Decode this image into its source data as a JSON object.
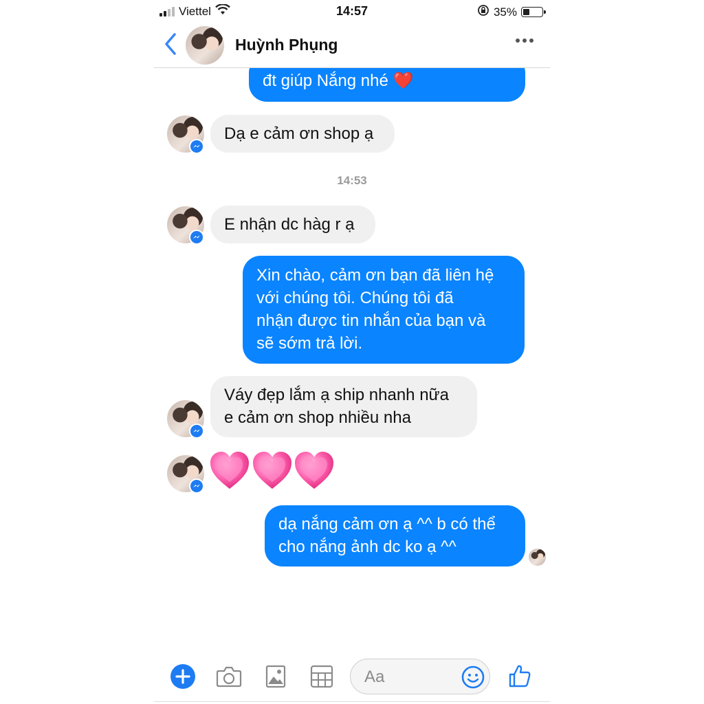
{
  "status_bar": {
    "carrier": "Viettel",
    "time": "14:57",
    "battery": "35%",
    "battery_level": 0.35
  },
  "header": {
    "contact_name": "Huỳnh Phụng"
  },
  "timestamp": "14:53",
  "messages": [
    {
      "side": "out",
      "text": "đt giúp Nắng nhé ❤️"
    },
    {
      "side": "in",
      "text": "Dạ e cảm ơn shop ạ"
    },
    {
      "side": "in",
      "text": "E nhận dc hàg r ạ"
    },
    {
      "side": "out",
      "lines": [
        "Xin chào, cảm ơn bạn đã liên hệ",
        "với chúng tôi. Chúng tôi đã",
        "nhận được tin nhắn của bạn và",
        "sẽ sớm trả lời."
      ]
    },
    {
      "side": "in",
      "lines": [
        "Váy đẹp lắm ạ ship nhanh nữa",
        "e cảm ơn shop nhiều nha"
      ]
    },
    {
      "side": "in",
      "emoji": [
        "💗",
        "💗",
        "💗"
      ]
    },
    {
      "side": "out",
      "lines": [
        "dạ nắng cảm ơn ạ ^^ b có thể",
        "cho nắng ảnh dc ko ạ ^^"
      ]
    }
  ],
  "composer": {
    "placeholder": "Aa"
  },
  "colors": {
    "outgoing_bubble": "#0a84ff",
    "incoming_bubble": "#f0f0f0",
    "accent": "#0a84ff"
  },
  "icons": [
    "back-chevron-icon",
    "more-dots-icon",
    "messenger-badge-icon",
    "add-icon",
    "camera-icon",
    "gallery-icon",
    "grid-icon",
    "emoji-icon",
    "thumbs-up-icon"
  ]
}
